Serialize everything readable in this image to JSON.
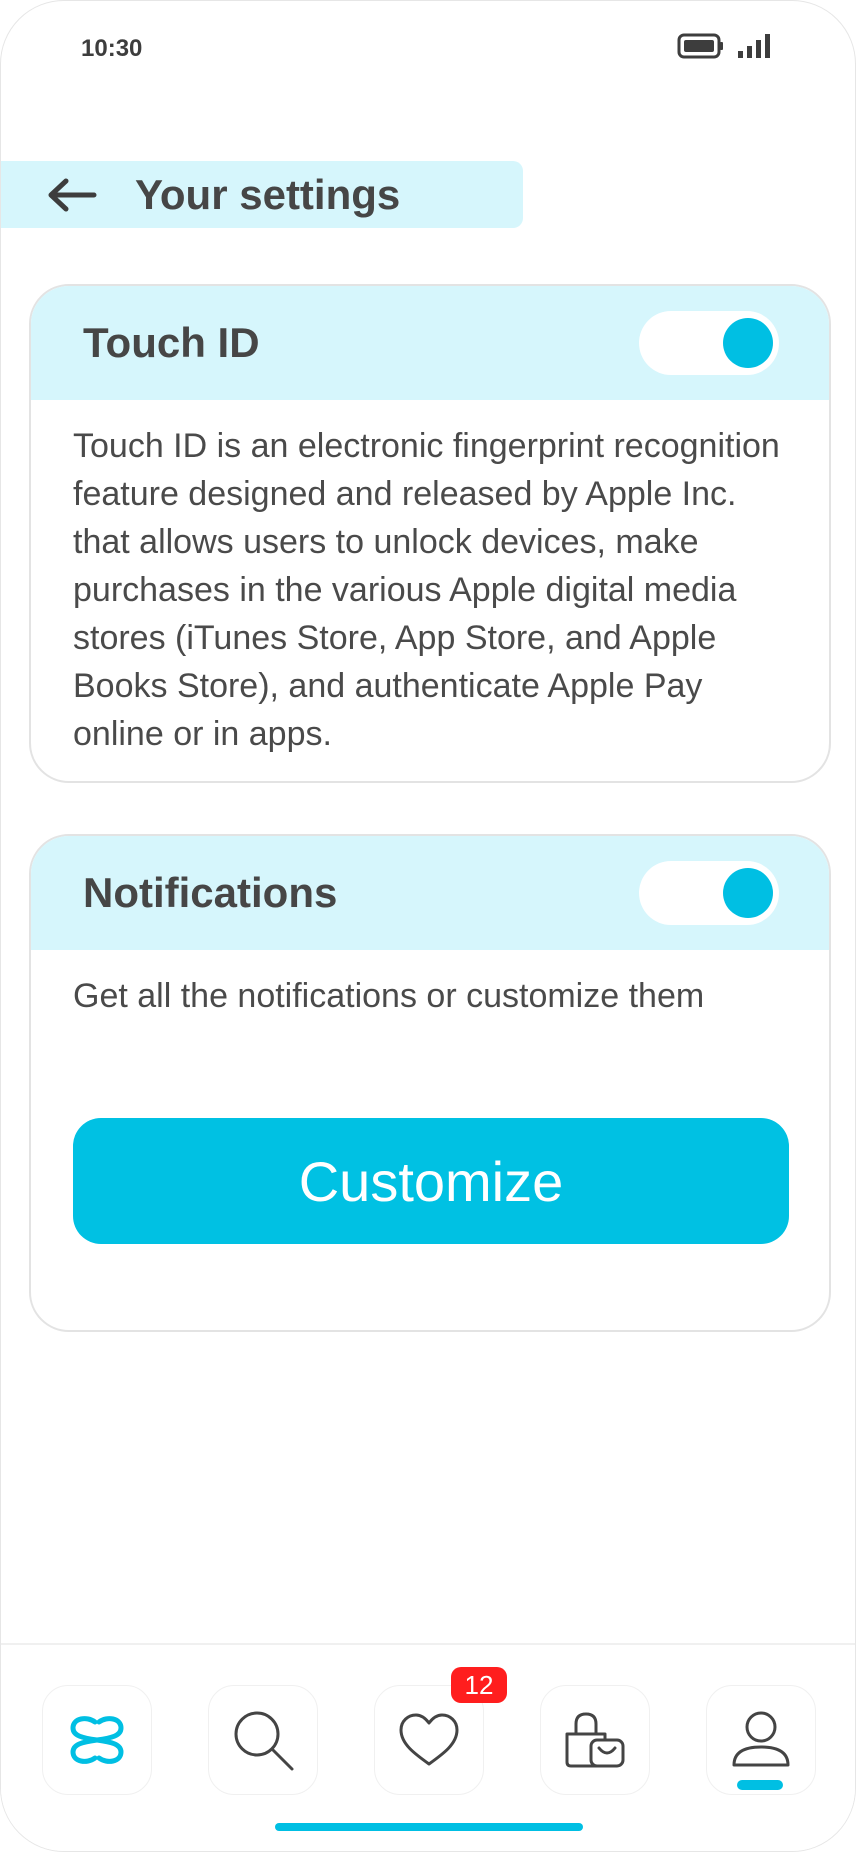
{
  "status_bar": {
    "time": "10:30",
    "icons": [
      "battery-icon",
      "signal-icon"
    ]
  },
  "header": {
    "title": "Your settings",
    "back_icon": "arrow-left-icon"
  },
  "touch_id": {
    "title": "Touch ID",
    "enabled": true,
    "description": "Touch ID is an electronic fingerprint recognition feature designed and released by Apple Inc. that allows users to unlock devices, make purchases in the various Apple digital media stores (iTunes Store, App Store, and Apple Books Store), and authenticate Apple Pay online or in apps."
  },
  "notifications": {
    "title": "Notifications",
    "enabled": true,
    "description": "Get all the notifications or customize them",
    "button_label": "Customize"
  },
  "bottom_nav": {
    "items": [
      {
        "icon": "logo-icon",
        "active": false
      },
      {
        "icon": "search-icon",
        "active": false
      },
      {
        "icon": "heart-icon",
        "active": false,
        "badge": "12"
      },
      {
        "icon": "shopping-bag-icon",
        "active": false
      },
      {
        "icon": "user-icon",
        "active": true
      }
    ]
  },
  "colors": {
    "accent": "#00bfe3",
    "header_bg": "#d6f6fc",
    "badge": "#ff1e1e",
    "text": "#464646"
  }
}
